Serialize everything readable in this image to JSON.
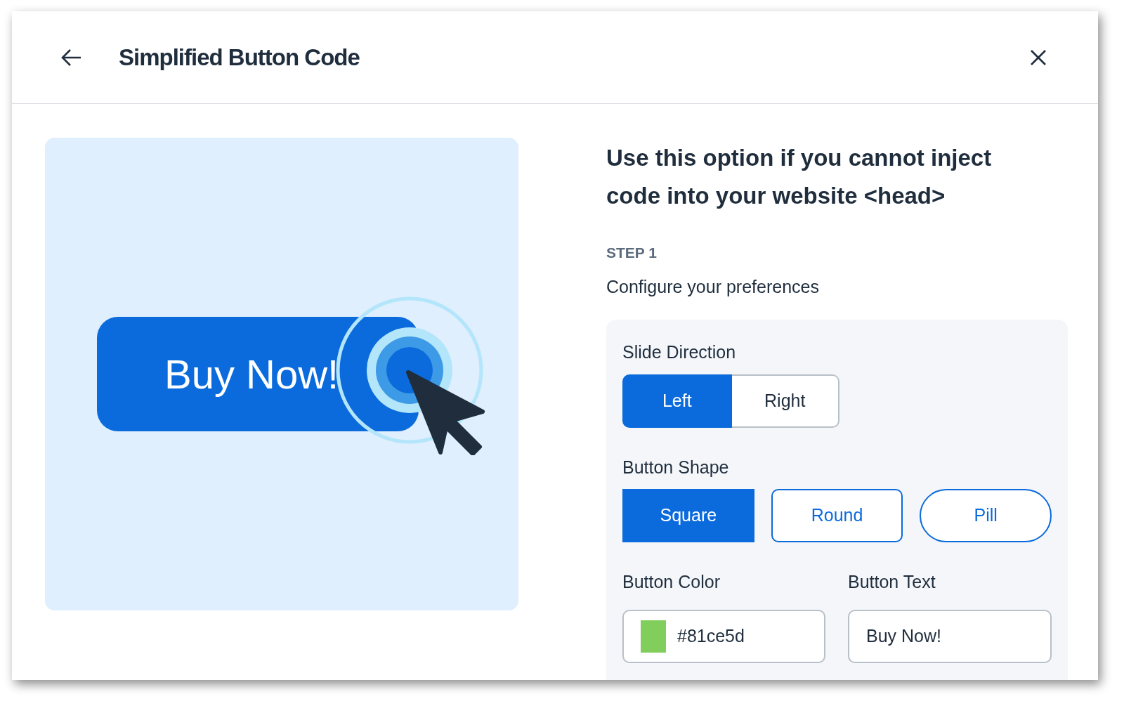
{
  "header": {
    "title": "Simplified Button Code"
  },
  "preview": {
    "button_text": "Buy Now!"
  },
  "intro": {
    "heading": "Use this option if you cannot inject code into your website <head>",
    "step_label": "STEP 1",
    "step_text": "Configure your preferences"
  },
  "slide_direction": {
    "label": "Slide Direction",
    "options": [
      {
        "label": "Left",
        "selected": true
      },
      {
        "label": "Right",
        "selected": false
      }
    ]
  },
  "button_shape": {
    "label": "Button Shape",
    "options": [
      {
        "label": "Square",
        "kind": "square",
        "selected": true
      },
      {
        "label": "Round",
        "kind": "round",
        "selected": false
      },
      {
        "label": "Pill",
        "kind": "pill",
        "selected": false
      }
    ]
  },
  "button_color": {
    "label": "Button Color",
    "value": "#81ce5d",
    "color": "#81ce5d"
  },
  "button_text": {
    "label": "Button Text",
    "value": "Buy Now!"
  }
}
